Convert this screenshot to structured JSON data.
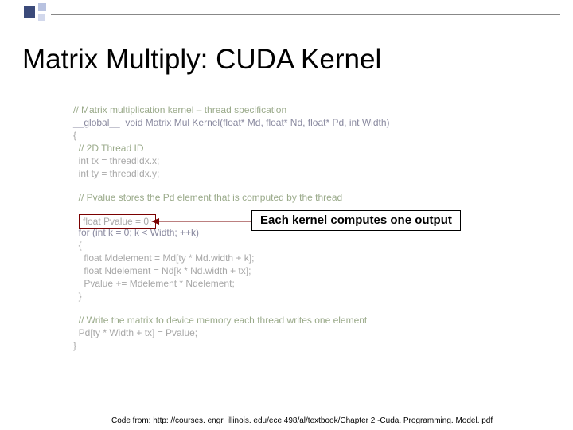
{
  "slide": {
    "title": "Matrix Multiply:  CUDA Kernel",
    "annotation": "Each kernel computes one output",
    "footer_prefix": "Code from:  ",
    "footer_url": "http: //courses. engr. illinois. edu/ece 498/al/textbook/Chapter 2 -Cuda. Programming. Model. pdf"
  },
  "code": {
    "l01": "// Matrix multiplication kernel – thread specification",
    "l02": "__global__  void Matrix Mul Kernel(float* Md, float* Nd, float* Pd, int Width)",
    "l03": "{",
    "l04": "  // 2D Thread ID",
    "l05": "  int tx = threadIdx.x;",
    "l06": "  int ty = threadIdx.y;",
    "l07": "  // Pvalue stores the Pd element that is computed by the thread",
    "pvalue": "float Pvalue = 0;",
    "l09": "  for (int k = 0; k < Width; ++k)",
    "l10": "  {",
    "l11": "    float Mdelement = Md[ty * Md.width + k];",
    "l12": "    float Ndelement = Nd[k * Nd.width + tx];",
    "l13": "    Pvalue += Mdelement * Ndelement;",
    "l14": "  }",
    "l15": "  // Write the matrix to device memory each thread writes one element",
    "l16": "  Pd[ty * Width + tx] = Pvalue;",
    "l17": "}"
  }
}
